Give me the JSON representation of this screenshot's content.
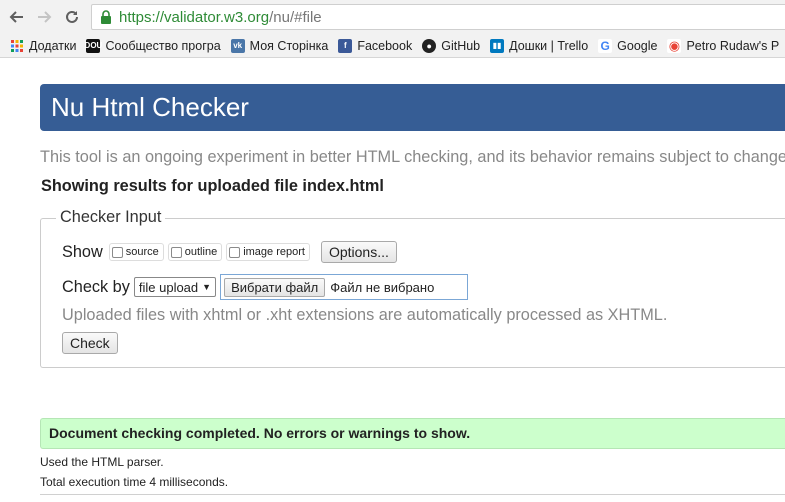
{
  "browser": {
    "url_host": "https://validator.w3.org",
    "url_path": "/nu/#file",
    "bookmarks": [
      {
        "label": "Додатки",
        "icon": "apps-grid-icon",
        "color": "#e84235"
      },
      {
        "label": "Сообщество програ",
        "icon": "dou-icon",
        "color": "#111111",
        "glyph": "DOU"
      },
      {
        "label": "Моя Сторінка",
        "icon": "vk-icon",
        "color": "#4a76a8",
        "glyph": "vk"
      },
      {
        "label": "Facebook",
        "icon": "facebook-icon",
        "color": "#3b5998",
        "glyph": "f"
      },
      {
        "label": "GitHub",
        "icon": "github-icon",
        "color": "#222222",
        "glyph": "●"
      },
      {
        "label": "Дошки | Trello",
        "icon": "trello-icon",
        "color": "#0079bf",
        "glyph": "▮▮"
      },
      {
        "label": "Google",
        "icon": "google-icon",
        "color": "#4285f4",
        "glyph": "G"
      },
      {
        "label": "Petro Rudaw's P",
        "icon": "chrome-icon",
        "color": "#e84235",
        "glyph": "◉"
      }
    ]
  },
  "page": {
    "title": "Nu Html Checker",
    "intro": "This tool is an ongoing experiment in better HTML checking, and its behavior remains subject to change",
    "results_heading": "Showing results for uploaded file index.html",
    "checker": {
      "legend": "Checker Input",
      "show_label": "Show",
      "options": [
        "source",
        "outline",
        "image report"
      ],
      "options_button": "Options...",
      "check_by_label": "Check by",
      "check_by_value": "file upload",
      "file_button": "Вибрати файл",
      "file_none": "Файл не вибрано",
      "note": "Uploaded files with xhtml or .xht extensions are automatically processed as XHTML.",
      "check_button": "Check"
    },
    "result": {
      "message": "Document checking completed. No errors or warnings to show.",
      "parser": "Used the HTML parser.",
      "time": "Total execution time 4 milliseconds."
    }
  }
}
